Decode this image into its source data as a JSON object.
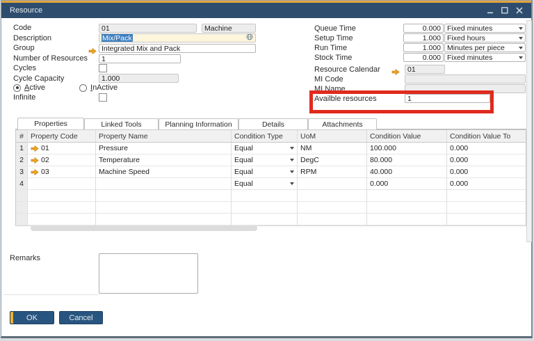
{
  "window": {
    "title": "Resource"
  },
  "form_left": {
    "code_label": "Code",
    "code_value": "01",
    "code_type": "Machine",
    "description_label": "Description",
    "description_value": "Mix/Pack",
    "group_label": "Group",
    "group_value": "Integrated Mix and Pack",
    "number_of_resources_label": "Number of Resources",
    "number_of_resources_value": "1",
    "cycles_label": "Cycles",
    "cycle_capacity_label": "Cycle Capacity",
    "cycle_capacity_value": "1.000",
    "active_first": "A",
    "active_rest": "ctive",
    "inactive_first": "I",
    "inactive_rest": "nActive",
    "infinite_label": "Infinite"
  },
  "form_right": {
    "queue_time_label": "Queue Time",
    "queue_time_value": "0.000",
    "queue_time_unit": "Fixed minutes",
    "setup_time_label": "Setup Time",
    "setup_time_value": "1.000",
    "setup_time_unit": "Fixed hours",
    "run_time_label": "Run Time",
    "run_time_value": "1.000",
    "run_time_unit": "Minutes per piece",
    "stock_time_label": "Stock Time",
    "stock_time_value": "0.000",
    "stock_time_unit": "Fixed minutes",
    "resource_calendar_label": "Resource Calendar",
    "resource_calendar_value": "01",
    "mi_code_label": "MI Code",
    "mi_code_value": "",
    "mi_name_label": "MI Name",
    "mi_name_value": "",
    "available_resources_label": "Availble resources",
    "available_resources_value": "1"
  },
  "tabs": [
    {
      "label": "Properties",
      "active": true
    },
    {
      "label": "Linked Tools",
      "active": false
    },
    {
      "label": "Planning Information",
      "active": false
    },
    {
      "label": "Details",
      "active": false
    },
    {
      "label": "Attachments",
      "active": false
    }
  ],
  "table": {
    "columns": [
      "#",
      "Property Code",
      "Property Name",
      "Condition Type",
      "UoM",
      "Condition Value",
      "Condition Value To"
    ],
    "rows": [
      {
        "num": "1",
        "code": "01",
        "name": "Pressure",
        "condition": "Equal",
        "uom": "NM",
        "value": "100.000",
        "value_to": "0.000"
      },
      {
        "num": "2",
        "code": "02",
        "name": "Temperature",
        "condition": "Equal",
        "uom": "DegC",
        "value": "80.000",
        "value_to": "0.000"
      },
      {
        "num": "3",
        "code": "03",
        "name": "Machine Speed",
        "condition": "Equal",
        "uom": "RPM",
        "value": "40.000",
        "value_to": "0.000"
      },
      {
        "num": "4",
        "code": "",
        "name": "",
        "condition": "Equal",
        "uom": "",
        "value": "0.000",
        "value_to": "0.000"
      }
    ]
  },
  "remarks_label": "Remarks",
  "buttons": {
    "ok": "OK",
    "cancel": "Cancel"
  },
  "icons": {
    "link_arrow": "orange right arrow",
    "dropdown": "down triangle",
    "globe": "language globe",
    "minimize": "–",
    "maximize": "□",
    "close": "✕"
  },
  "colors": {
    "title_bar": "#2e4d6e",
    "accent_gold": "#e2a43c",
    "button_navy": "#285580",
    "annotation_red": "#e02a1e",
    "selection_blue": "#3c7ebf",
    "field_gray": "#ededed",
    "description_cream": "#fdf5dc"
  }
}
